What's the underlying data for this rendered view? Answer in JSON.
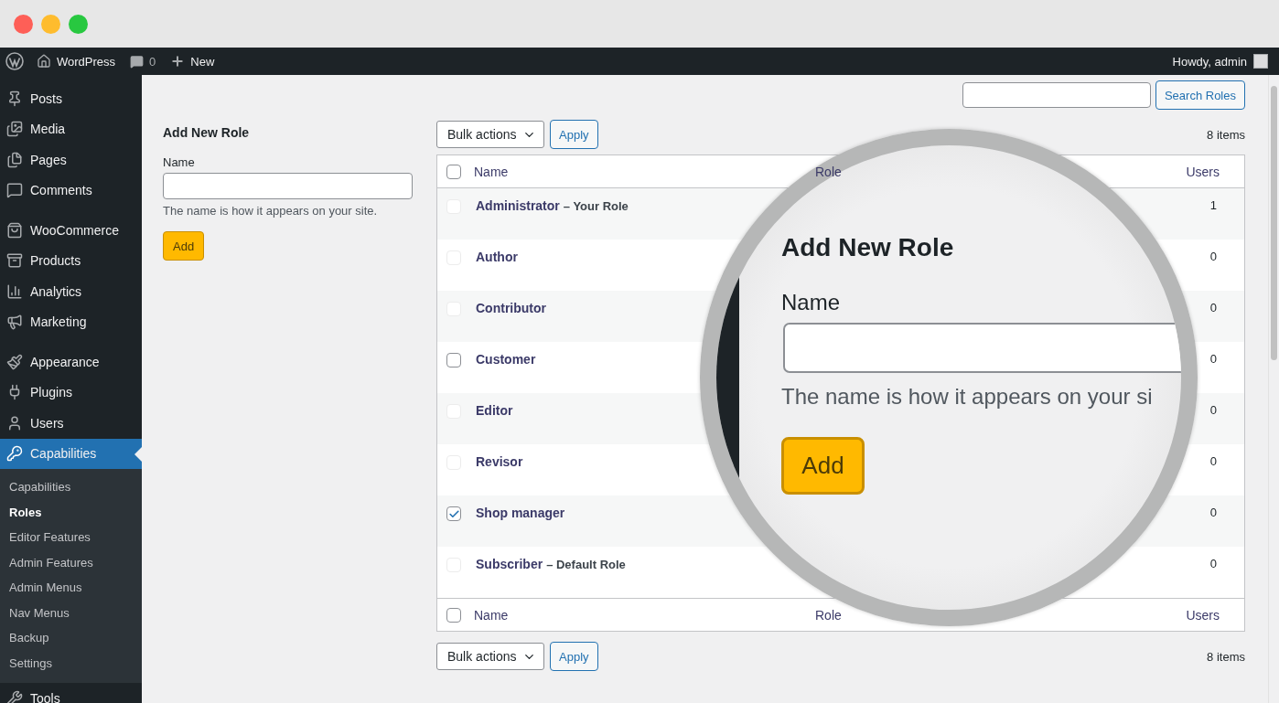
{
  "admin_bar": {
    "site": "WordPress",
    "comments": "0",
    "new": "New",
    "greeting": "Howdy, admin"
  },
  "sidebar": {
    "groups": [
      {
        "items": [
          {
            "label": "Posts",
            "selected": false
          },
          {
            "label": "Media",
            "selected": false
          },
          {
            "label": "Pages",
            "selected": false
          },
          {
            "label": "Comments",
            "selected": false
          }
        ]
      },
      {
        "items": [
          {
            "label": "WooCommerce",
            "selected": false
          },
          {
            "label": "Products",
            "selected": false
          },
          {
            "label": "Analytics",
            "selected": false
          },
          {
            "label": "Marketing",
            "selected": false
          }
        ]
      },
      {
        "items": [
          {
            "label": "Appearance",
            "selected": false
          },
          {
            "label": "Plugins",
            "selected": false
          },
          {
            "label": "Users",
            "selected": false
          },
          {
            "label": "Capabilities",
            "selected": true,
            "submenu": [
              {
                "label": "Capabilities",
                "selected": false
              },
              {
                "label": "Roles",
                "selected": true
              },
              {
                "label": "Editor Features",
                "selected": false
              },
              {
                "label": "Admin Features",
                "selected": false
              },
              {
                "label": "Admin Menus",
                "selected": false
              },
              {
                "label": "Nav Menus",
                "selected": false
              },
              {
                "label": "Backup",
                "selected": false
              },
              {
                "label": "Settings",
                "selected": false
              }
            ]
          }
        ]
      },
      {
        "items": [
          {
            "label": "Tools",
            "selected": false
          }
        ]
      }
    ]
  },
  "add_form": {
    "title": "Add New Role",
    "label": "Name",
    "description": "The name is how it appears on your site.",
    "button": "Add"
  },
  "search": {
    "button": "Search Roles"
  },
  "bulk_top": {
    "select": "Bulk actions",
    "apply": "Apply",
    "count": "8 items"
  },
  "table": {
    "select_all_checked": false,
    "columns": [
      "Name",
      "Role",
      "Users"
    ],
    "rows": [
      {
        "name": "Administrator",
        "note": "– Your Role",
        "users": "1",
        "checked": false,
        "disabled": true
      },
      {
        "name": "Author",
        "users": "0",
        "checked": false,
        "disabled": true
      },
      {
        "name": "Contributor",
        "users": "0",
        "checked": false,
        "disabled": true
      },
      {
        "name": "Customer",
        "users": "0",
        "checked": false,
        "disabled": false
      },
      {
        "name": "Editor",
        "users": "0",
        "checked": false,
        "disabled": true
      },
      {
        "name": "Revisor",
        "users": "0",
        "checked": false,
        "disabled": true
      },
      {
        "name": "Shop manager",
        "users": "0",
        "checked": true,
        "disabled": false
      },
      {
        "name": "Subscriber",
        "note": "– Default Role",
        "users": "0",
        "checked": false,
        "disabled": true
      }
    ],
    "footer_columns": [
      "Name",
      "Role",
      "Users"
    ]
  },
  "bulk_bottom": {
    "select": "Bulk actions",
    "apply": "Apply",
    "count": "8 items"
  },
  "magnifier": {
    "title": "Add New Role",
    "label": "Name",
    "description": "The name is how it appears on your si",
    "button": "Add"
  }
}
